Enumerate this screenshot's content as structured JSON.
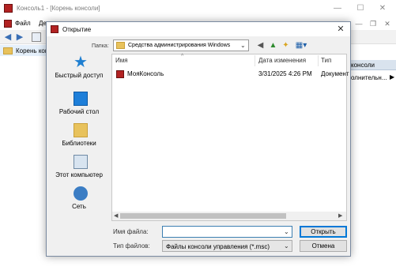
{
  "mmc": {
    "title": "Консоль1 - [Корень консоли]",
    "menu": [
      "Файл",
      "Де"
    ],
    "tree_root": "Корень консоли",
    "actions_header": "консоли",
    "actions_item": "олнительн...",
    "actions_arrow": "▶"
  },
  "dialog": {
    "title": "Открытие",
    "close_glyph": "✕",
    "look_in_label": "Папка:",
    "look_in_value": "Средства администрирования Windows",
    "places": [
      {
        "label": "Быстрый доступ",
        "icon": "star-icon"
      },
      {
        "label": "Рабочий стол",
        "icon": "desktop-icon"
      },
      {
        "label": "Библиотеки",
        "icon": "library-icon"
      },
      {
        "label": "Этот компьютер",
        "icon": "computer-icon"
      },
      {
        "label": "Сеть",
        "icon": "network-icon"
      }
    ],
    "columns": {
      "name": "Имя",
      "date": "Дата изменения",
      "type": "Тип"
    },
    "files": [
      {
        "name": "МояКонсоль",
        "date": "3/31/2025 4:26 PM",
        "type": "Документ"
      }
    ],
    "file_name_label": "Имя файла:",
    "file_name_value": "",
    "file_type_label": "Тип файлов:",
    "file_type_value": "Файлы консоли управления (*.msc)",
    "open_button": "Открыть",
    "cancel_button": "Отмена"
  },
  "colors": {
    "accent": "#0078d7",
    "desktop_blue": "#1e7fd9",
    "folder": "#e8c25c"
  }
}
